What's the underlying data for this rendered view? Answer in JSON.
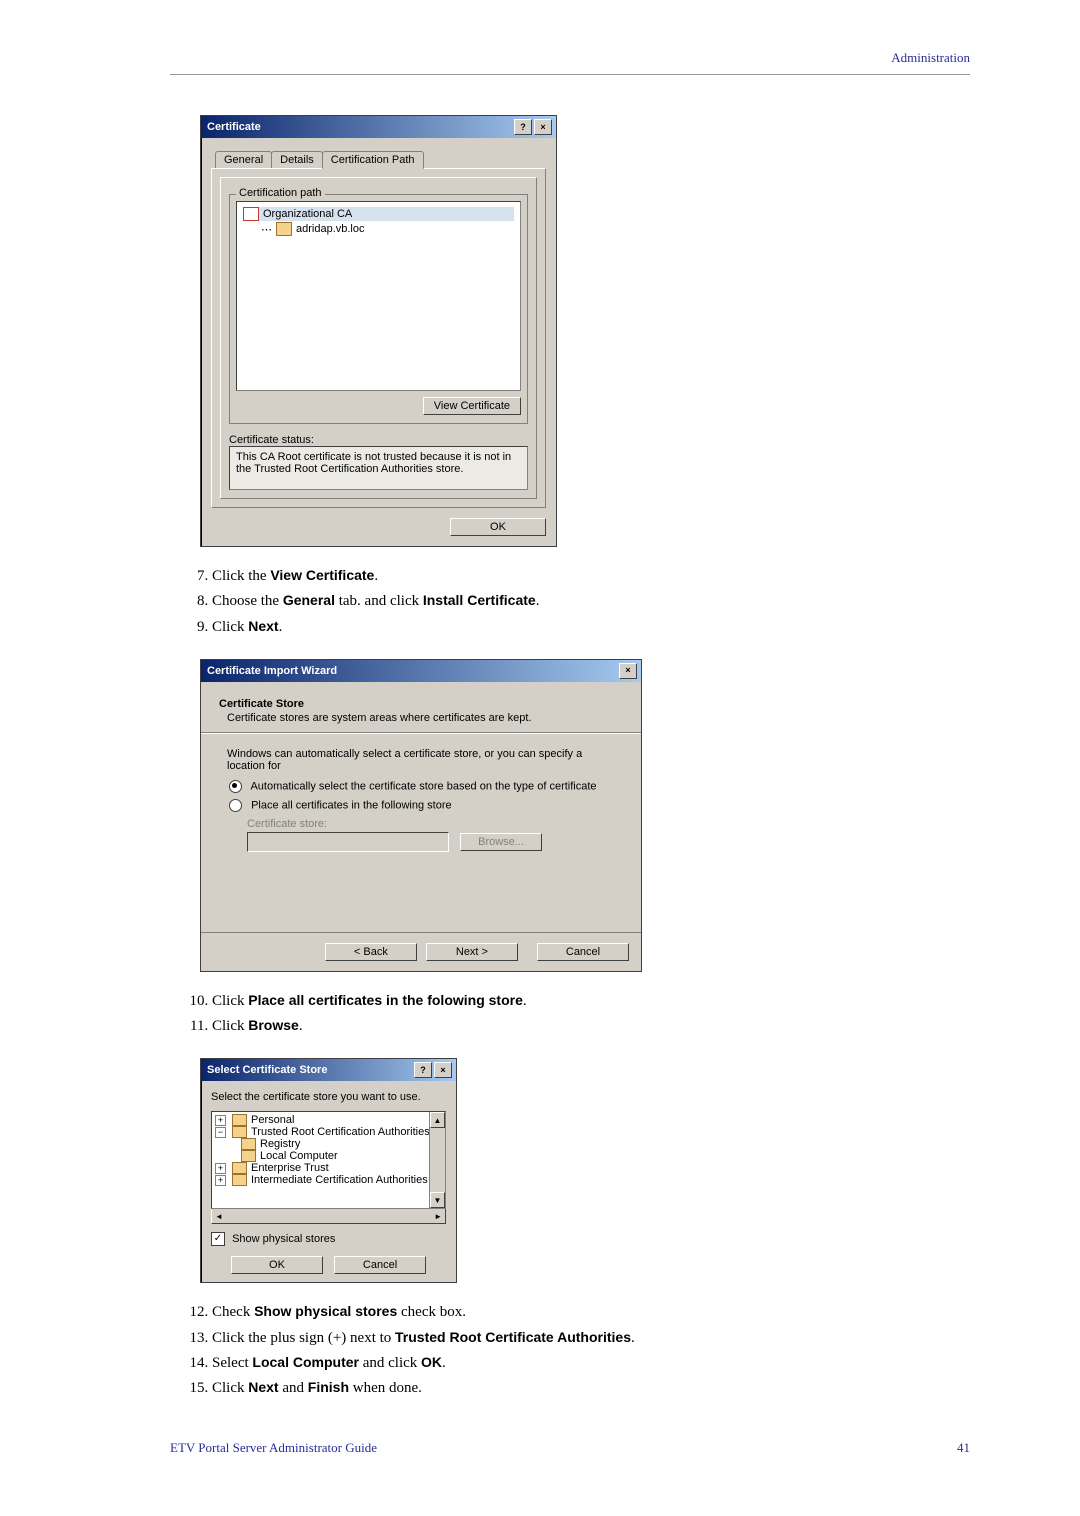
{
  "header": {
    "section": "Administration"
  },
  "footer": {
    "guide": "ETV Portal Server Administrator Guide",
    "page": "41"
  },
  "steps_a": [
    {
      "pre": "Click the ",
      "b": "View Certificate",
      "post": "."
    },
    {
      "pre": "Choose the ",
      "b": "General",
      "mid": " tab. and click ",
      "b2": "Install Certificate",
      "post": "."
    },
    {
      "pre": "Click ",
      "b": "Next",
      "post": "."
    }
  ],
  "steps_b": [
    {
      "pre": "Click ",
      "b": "Place all certificates in the folowing store",
      "post": "."
    },
    {
      "pre": "Click ",
      "b": "Browse",
      "post": "."
    }
  ],
  "steps_c": [
    {
      "pre": "Check ",
      "b": "Show physical stores",
      "post": " check box."
    },
    {
      "pre": "Click the plus sign (+) next to ",
      "b": "Trusted Root Certificate Authorities",
      "post": "."
    },
    {
      "pre": "Select ",
      "b": "Local Computer",
      "mid": " and click ",
      "b2": "OK",
      "post": "."
    },
    {
      "pre": "Click ",
      "b": "Next",
      "mid": " and ",
      "b2": "Finish",
      "post": " when done."
    }
  ],
  "dlg1": {
    "title": "Certificate",
    "tabs": {
      "general": "General",
      "details": "Details",
      "path": "Certification Path"
    },
    "group_label": "Certification path",
    "tree": {
      "root": "Organizational CA",
      "child": "adridap.vb.loc"
    },
    "view_btn": "View Certificate",
    "status_label": "Certificate status:",
    "status_text": "This CA Root certificate is not trusted because it is not in the Trusted Root Certification Authorities store.",
    "ok": "OK"
  },
  "dlg2": {
    "title": "Certificate Import Wizard",
    "heading": "Certificate Store",
    "subtext": "Certificate stores are system areas where certificates are kept.",
    "para": "Windows can automatically select a certificate store, or you can specify a location for",
    "radio_auto": "Automatically select the certificate store based on the type of certificate",
    "radio_place": "Place all certificates in the following store",
    "store_label": "Certificate store:",
    "browse": "Browse...",
    "back": "< Back",
    "next": "Next >",
    "cancel": "Cancel"
  },
  "dlg3": {
    "title": "Select Certificate Store",
    "prompt": "Select the certificate store you want to use.",
    "items": {
      "personal": "Personal",
      "trca": "Trusted Root Certification Authorities",
      "registry": "Registry",
      "local": "Local Computer",
      "et": "Enterprise Trust",
      "ica": "Intermediate Certification Authorities"
    },
    "show_phys": "Show physical stores",
    "ok": "OK",
    "cancel": "Cancel"
  }
}
